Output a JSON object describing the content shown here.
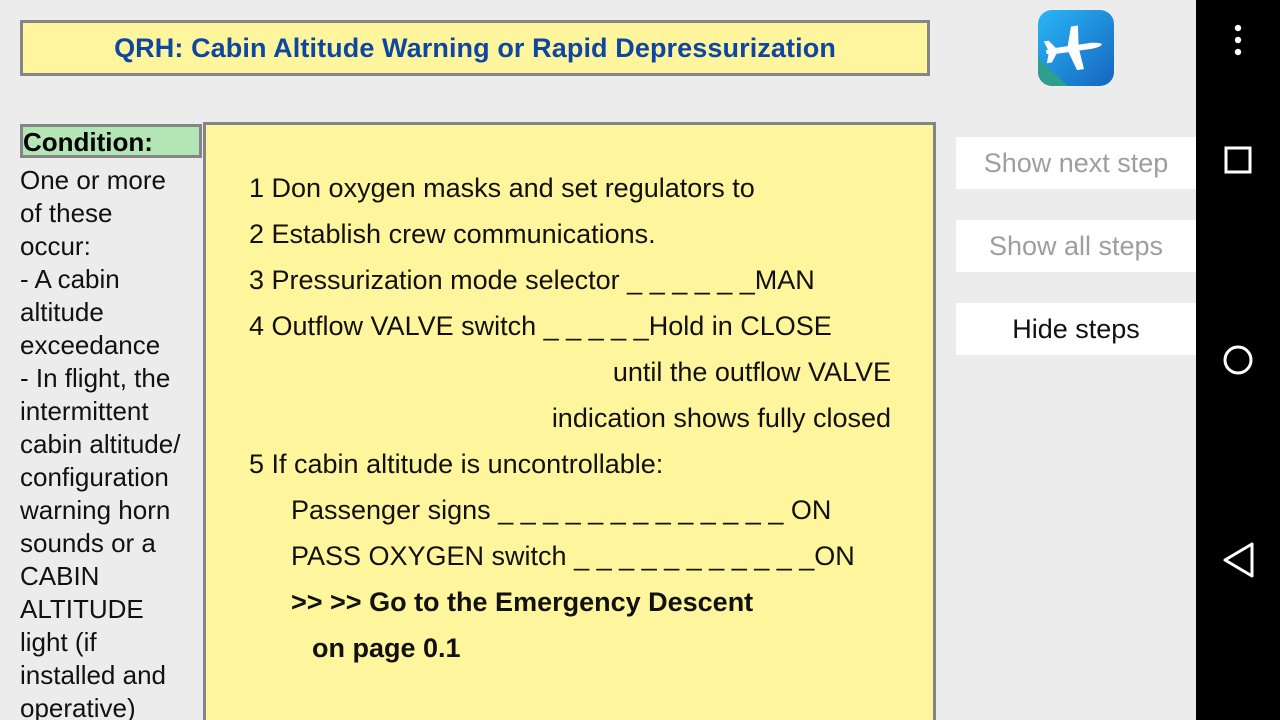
{
  "title": "QRH: Cabin Altitude Warning or Rapid Depressurization",
  "condition": {
    "header": "Condition:",
    "text": "One or more\nof these\noccur:\n- A cabin\naltitude\nexceedance\n- In flight, the\nintermittent\ncabin altitude/\nconfiguration\nwarning horn\nsounds or a\nCABIN\nALTITUDE\nlight (if\ninstalled and\noperative)"
  },
  "steps": {
    "s1": "1 Don oxygen masks and set regulators to",
    "s2": "2 Establish crew communications.",
    "s3": "3 Pressurization mode selector _ _ _ _ _ _MAN",
    "s4": "4 Outflow VALVE switch _ _ _ _ _Hold in CLOSE",
    "s4b": "until the outflow VALVE",
    "s4c": "indication shows fully closed",
    "s5": "5 If cabin altitude is uncontrollable:",
    "s5a": "Passenger signs _ _ _ _ _ _ _ _ _ _ _ _ _ ON",
    "s5b": "PASS OXYGEN switch _ _ _ _ _ _ _ _ _ _ _ON",
    "s5c": ">> >> Go to the Emergency Descent",
    "s5d": "on page 0.1"
  },
  "buttons": {
    "next": "Show next step",
    "all": "Show all steps",
    "hide": "Hide steps"
  },
  "icons": {
    "app": "airplane-app-icon",
    "menu": "more-vert-icon",
    "recents": "square-icon",
    "home": "circle-icon",
    "back": "triangle-back-icon"
  },
  "colors": {
    "title_text": "#0d47a1",
    "panel_bg": "#fff59d",
    "condition_bg": "#b3e6b5"
  }
}
